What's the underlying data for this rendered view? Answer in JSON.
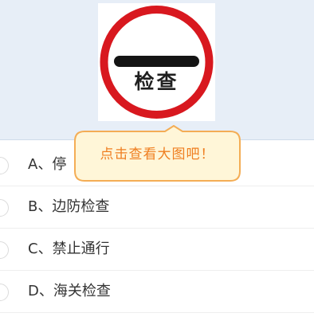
{
  "question": {
    "image": {
      "sign_text": "检查",
      "icon": "traffic-sign-icon",
      "colors": {
        "ring": "#d8181f",
        "bar": "#141414",
        "text": "#1f1f1f",
        "background": "#ffffff"
      }
    },
    "tooltip": {
      "text": "点击查看大图吧！",
      "colors": {
        "background": "#fff6d8",
        "border": "#f4ad55",
        "text": "#ef7f21"
      }
    },
    "options": [
      {
        "label": "A、停"
      },
      {
        "label": "B、边防检查"
      },
      {
        "label": "C、禁止通行"
      },
      {
        "label": "D、海关检查"
      }
    ]
  }
}
